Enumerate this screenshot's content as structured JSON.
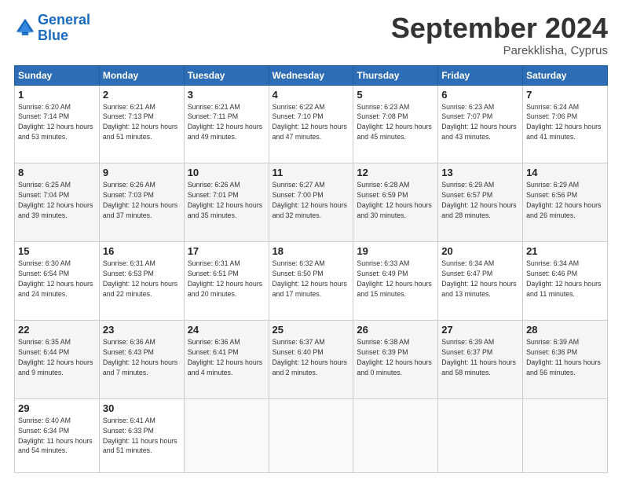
{
  "header": {
    "logo_line1": "General",
    "logo_line2": "Blue",
    "month": "September 2024",
    "location": "Parekklisha, Cyprus"
  },
  "days_of_week": [
    "Sunday",
    "Monday",
    "Tuesday",
    "Wednesday",
    "Thursday",
    "Friday",
    "Saturday"
  ],
  "weeks": [
    [
      {
        "day": 1,
        "sunrise": "6:20 AM",
        "sunset": "7:14 PM",
        "daylight": "12 hours and 53 minutes."
      },
      {
        "day": 2,
        "sunrise": "6:21 AM",
        "sunset": "7:13 PM",
        "daylight": "12 hours and 51 minutes."
      },
      {
        "day": 3,
        "sunrise": "6:21 AM",
        "sunset": "7:11 PM",
        "daylight": "12 hours and 49 minutes."
      },
      {
        "day": 4,
        "sunrise": "6:22 AM",
        "sunset": "7:10 PM",
        "daylight": "12 hours and 47 minutes."
      },
      {
        "day": 5,
        "sunrise": "6:23 AM",
        "sunset": "7:08 PM",
        "daylight": "12 hours and 45 minutes."
      },
      {
        "day": 6,
        "sunrise": "6:23 AM",
        "sunset": "7:07 PM",
        "daylight": "12 hours and 43 minutes."
      },
      {
        "day": 7,
        "sunrise": "6:24 AM",
        "sunset": "7:06 PM",
        "daylight": "12 hours and 41 minutes."
      }
    ],
    [
      {
        "day": 8,
        "sunrise": "6:25 AM",
        "sunset": "7:04 PM",
        "daylight": "12 hours and 39 minutes."
      },
      {
        "day": 9,
        "sunrise": "6:26 AM",
        "sunset": "7:03 PM",
        "daylight": "12 hours and 37 minutes."
      },
      {
        "day": 10,
        "sunrise": "6:26 AM",
        "sunset": "7:01 PM",
        "daylight": "12 hours and 35 minutes."
      },
      {
        "day": 11,
        "sunrise": "6:27 AM",
        "sunset": "7:00 PM",
        "daylight": "12 hours and 32 minutes."
      },
      {
        "day": 12,
        "sunrise": "6:28 AM",
        "sunset": "6:59 PM",
        "daylight": "12 hours and 30 minutes."
      },
      {
        "day": 13,
        "sunrise": "6:29 AM",
        "sunset": "6:57 PM",
        "daylight": "12 hours and 28 minutes."
      },
      {
        "day": 14,
        "sunrise": "6:29 AM",
        "sunset": "6:56 PM",
        "daylight": "12 hours and 26 minutes."
      }
    ],
    [
      {
        "day": 15,
        "sunrise": "6:30 AM",
        "sunset": "6:54 PM",
        "daylight": "12 hours and 24 minutes."
      },
      {
        "day": 16,
        "sunrise": "6:31 AM",
        "sunset": "6:53 PM",
        "daylight": "12 hours and 22 minutes."
      },
      {
        "day": 17,
        "sunrise": "6:31 AM",
        "sunset": "6:51 PM",
        "daylight": "12 hours and 20 minutes."
      },
      {
        "day": 18,
        "sunrise": "6:32 AM",
        "sunset": "6:50 PM",
        "daylight": "12 hours and 17 minutes."
      },
      {
        "day": 19,
        "sunrise": "6:33 AM",
        "sunset": "6:49 PM",
        "daylight": "12 hours and 15 minutes."
      },
      {
        "day": 20,
        "sunrise": "6:34 AM",
        "sunset": "6:47 PM",
        "daylight": "12 hours and 13 minutes."
      },
      {
        "day": 21,
        "sunrise": "6:34 AM",
        "sunset": "6:46 PM",
        "daylight": "12 hours and 11 minutes."
      }
    ],
    [
      {
        "day": 22,
        "sunrise": "6:35 AM",
        "sunset": "6:44 PM",
        "daylight": "12 hours and 9 minutes."
      },
      {
        "day": 23,
        "sunrise": "6:36 AM",
        "sunset": "6:43 PM",
        "daylight": "12 hours and 7 minutes."
      },
      {
        "day": 24,
        "sunrise": "6:36 AM",
        "sunset": "6:41 PM",
        "daylight": "12 hours and 4 minutes."
      },
      {
        "day": 25,
        "sunrise": "6:37 AM",
        "sunset": "6:40 PM",
        "daylight": "12 hours and 2 minutes."
      },
      {
        "day": 26,
        "sunrise": "6:38 AM",
        "sunset": "6:39 PM",
        "daylight": "12 hours and 0 minutes."
      },
      {
        "day": 27,
        "sunrise": "6:39 AM",
        "sunset": "6:37 PM",
        "daylight": "11 hours and 58 minutes."
      },
      {
        "day": 28,
        "sunrise": "6:39 AM",
        "sunset": "6:36 PM",
        "daylight": "11 hours and 56 minutes."
      }
    ],
    [
      {
        "day": 29,
        "sunrise": "6:40 AM",
        "sunset": "6:34 PM",
        "daylight": "11 hours and 54 minutes."
      },
      {
        "day": 30,
        "sunrise": "6:41 AM",
        "sunset": "6:33 PM",
        "daylight": "11 hours and 51 minutes."
      },
      null,
      null,
      null,
      null,
      null
    ]
  ]
}
